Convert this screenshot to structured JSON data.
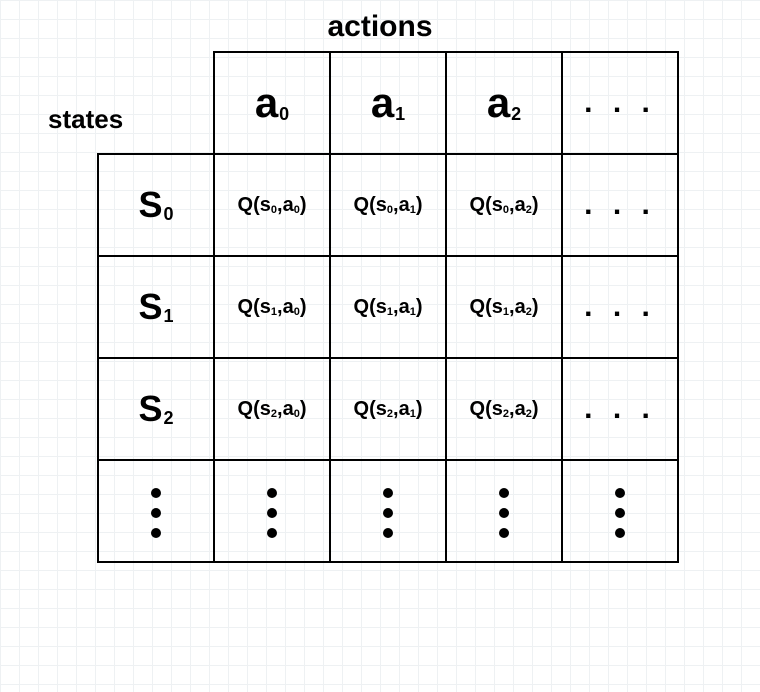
{
  "labels": {
    "actions": "actions",
    "states": "states"
  },
  "columns": [
    {
      "main": "a",
      "sub": "0"
    },
    {
      "main": "a",
      "sub": "1"
    },
    {
      "main": "a",
      "sub": "2"
    }
  ],
  "ellipsis_h": ". . .",
  "rows": [
    {
      "header": {
        "main": "S",
        "sub": "0"
      },
      "cells": [
        {
          "q": "Q",
          "s_main": "s",
          "s_sub": "0",
          "a_main": "a",
          "a_sub": "0"
        },
        {
          "q": "Q",
          "s_main": "s",
          "s_sub": "0",
          "a_main": "a",
          "a_sub": "1"
        },
        {
          "q": "Q",
          "s_main": "s",
          "s_sub": "0",
          "a_main": "a",
          "a_sub": "2"
        }
      ]
    },
    {
      "header": {
        "main": "S",
        "sub": "1"
      },
      "cells": [
        {
          "q": "Q",
          "s_main": "s",
          "s_sub": "1",
          "a_main": "a",
          "a_sub": "0"
        },
        {
          "q": "Q",
          "s_main": "s",
          "s_sub": "1",
          "a_main": "a",
          "a_sub": "1"
        },
        {
          "q": "Q",
          "s_main": "s",
          "s_sub": "1",
          "a_main": "a",
          "a_sub": "2"
        }
      ]
    },
    {
      "header": {
        "main": "S",
        "sub": "2"
      },
      "cells": [
        {
          "q": "Q",
          "s_main": "s",
          "s_sub": "2",
          "a_main": "a",
          "a_sub": "0"
        },
        {
          "q": "Q",
          "s_main": "s",
          "s_sub": "2",
          "a_main": "a",
          "a_sub": "1"
        },
        {
          "q": "Q",
          "s_main": "s",
          "s_sub": "2",
          "a_main": "a",
          "a_sub": "2"
        }
      ]
    }
  ],
  "chart_data": {
    "type": "table",
    "title": "",
    "row_axis_label": "states",
    "col_axis_label": "actions",
    "columns": [
      "a0",
      "a1",
      "a2",
      "..."
    ],
    "rows": [
      "S0",
      "S1",
      "S2",
      "..."
    ],
    "cells": [
      [
        "Q(s0,a0)",
        "Q(s0,a1)",
        "Q(s0,a2)",
        "..."
      ],
      [
        "Q(s1,a0)",
        "Q(s1,a1)",
        "Q(s1,a2)",
        "..."
      ],
      [
        "Q(s2,a0)",
        "Q(s2,a1)",
        "Q(s2,a2)",
        "..."
      ],
      [
        "...",
        "...",
        "...",
        "..."
      ]
    ]
  }
}
